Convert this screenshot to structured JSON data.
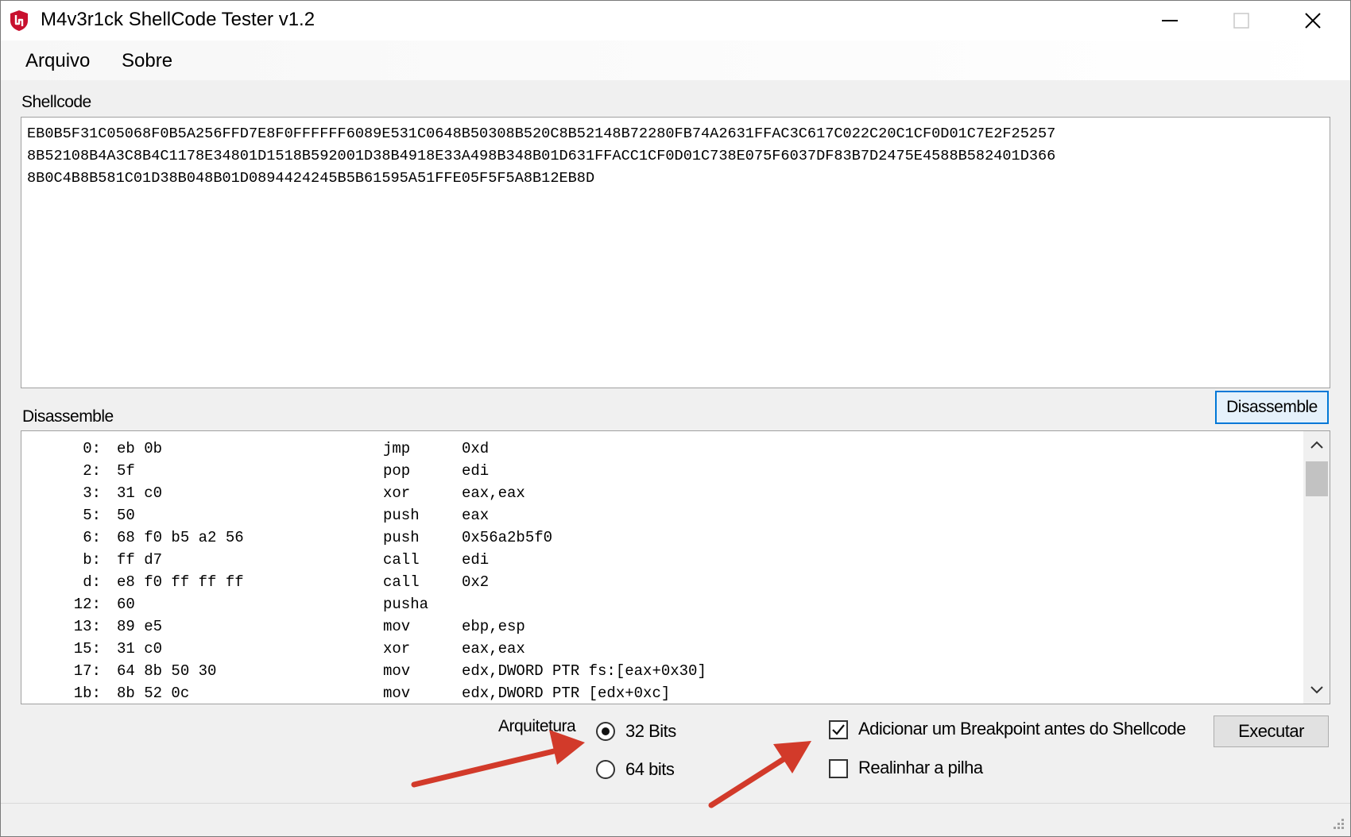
{
  "window": {
    "title": "M4v3r1ck ShellCode Tester v1.2",
    "app_icon": "shield-logo-icon"
  },
  "menu": {
    "items": [
      "Arquivo",
      "Sobre"
    ]
  },
  "shellcode": {
    "label": "Shellcode",
    "lines": [
      "EB0B5F31C05068F0B5A256FFD7E8F0FFFFFF6089E531C0648B50308B520C8B52148B72280FB74A2631FFAC3C617C022C20C1CF0D01C7E2F25257",
      "8B52108B4A3C8B4C1178E34801D1518B592001D38B4918E33A498B348B01D631FFACC1CF0D01C738E075F6037DF83B7D2475E4588B582401D366",
      "8B0C4B8B581C01D38B048B01D0894424245B5B61595A51FFE05F5F5A8B12EB8D"
    ]
  },
  "disassemble": {
    "label": "Disassemble",
    "button_label": "Disassemble",
    "rows": [
      {
        "offset": "0:",
        "bytes": "eb 0b",
        "mnemonic": "jmp",
        "operands": "0xd"
      },
      {
        "offset": "2:",
        "bytes": "5f",
        "mnemonic": "pop",
        "operands": "edi"
      },
      {
        "offset": "3:",
        "bytes": "31 c0",
        "mnemonic": "xor",
        "operands": "eax,eax"
      },
      {
        "offset": "5:",
        "bytes": "50",
        "mnemonic": "push",
        "operands": "eax"
      },
      {
        "offset": "6:",
        "bytes": "68 f0 b5 a2 56",
        "mnemonic": "push",
        "operands": "0x56a2b5f0"
      },
      {
        "offset": "b:",
        "bytes": "ff d7",
        "mnemonic": "call",
        "operands": "edi"
      },
      {
        "offset": "d:",
        "bytes": "e8 f0 ff ff ff",
        "mnemonic": "call",
        "operands": "0x2"
      },
      {
        "offset": "12:",
        "bytes": "60",
        "mnemonic": "pusha",
        "operands": ""
      },
      {
        "offset": "13:",
        "bytes": "89 e5",
        "mnemonic": "mov",
        "operands": "ebp,esp"
      },
      {
        "offset": "15:",
        "bytes": "31 c0",
        "mnemonic": "xor",
        "operands": "eax,eax"
      },
      {
        "offset": "17:",
        "bytes": "64 8b 50 30",
        "mnemonic": "mov",
        "operands": "edx,DWORD PTR fs:[eax+0x30]"
      },
      {
        "offset": "1b:",
        "bytes": "8b 52 0c",
        "mnemonic": "mov",
        "operands": "edx,DWORD PTR [edx+0xc]"
      }
    ]
  },
  "architecture": {
    "label": "Arquitetura",
    "options": [
      {
        "label": "32 Bits",
        "selected": true
      },
      {
        "label": "64 bits",
        "selected": false
      }
    ]
  },
  "options": {
    "breakpoint_label": "Adicionar um Breakpoint antes do Shellcode",
    "breakpoint_checked": true,
    "realign_label": "Realinhar a pilha",
    "realign_checked": false
  },
  "execute_button": "Executar",
  "colors": {
    "accent": "#0078d7",
    "annotation_arrow": "#d23a2a",
    "logo": "#c8102e"
  }
}
